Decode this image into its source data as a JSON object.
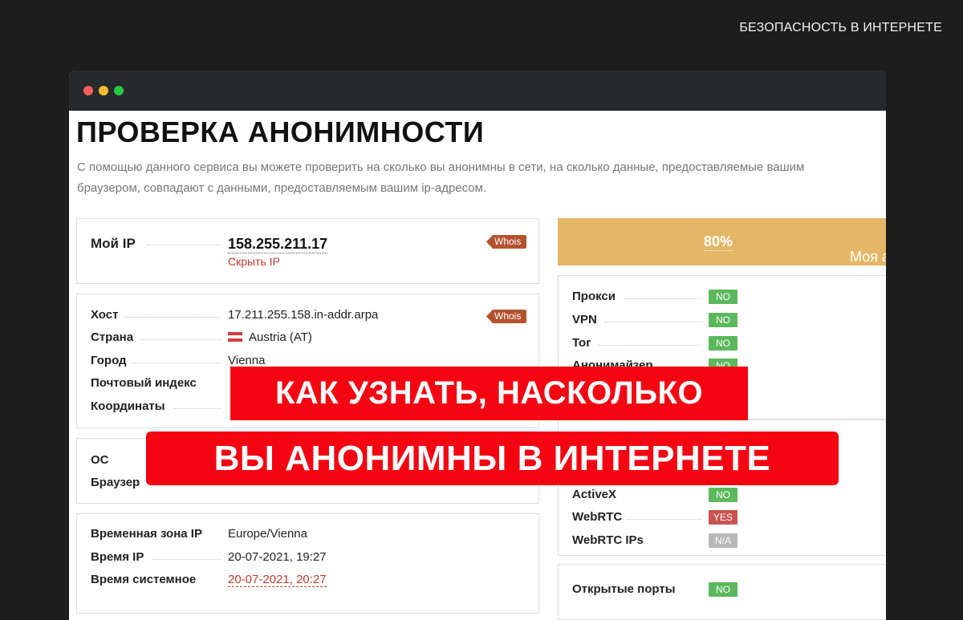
{
  "category": "БЕЗОПАСНОСТЬ В ИНТЕРНЕТЕ",
  "page": {
    "title": "ПРОВЕРКА АНОНИМНОСТИ",
    "description_line1": "С помощью данного сервиса вы можете проверить на сколько вы анонимны в сети, на сколько данные, предоставляемые вашим",
    "description_line2": "браузером, совпадают с данными, предоставляемым вашим ip-адресом."
  },
  "ip_box": {
    "label": "Мой IP",
    "value": "158.255.211.17",
    "hide_link": "Скрыть IP",
    "whois": "Whois"
  },
  "host_box": {
    "whois": "Whois",
    "rows": [
      {
        "label": "Хост",
        "value": "17.211.255.158.in-addr.arpa"
      },
      {
        "label": "Страна",
        "value": "Austria (AT)"
      },
      {
        "label": "Город",
        "value": "Vienna"
      },
      {
        "label": "Почтовый индекс",
        "value": ""
      },
      {
        "label": "Координаты",
        "value": ""
      }
    ]
  },
  "os_box": {
    "rows": [
      {
        "label": "ОС",
        "value": ""
      },
      {
        "label": "Браузер",
        "value": ""
      }
    ]
  },
  "time_box": {
    "rows": [
      {
        "label": "Временная зона IP",
        "value": "Europe/Vienna"
      },
      {
        "label": "Время IP",
        "value": "20-07-2021, 19:27"
      },
      {
        "label": "Время системное",
        "value": "20-07-2021, 20:27"
      }
    ]
  },
  "anonymity": {
    "label": "Моя анонимность:",
    "percent": "80%"
  },
  "checks_top": [
    {
      "label": "Прокси",
      "status": "NO"
    },
    {
      "label": "VPN",
      "status": "NO"
    },
    {
      "label": "Tor",
      "status": "NO"
    },
    {
      "label": "Анонимайзер",
      "status": "NO"
    }
  ],
  "checks_bottom": [
    {
      "label": "ActiveX",
      "status": "NO"
    },
    {
      "label": "WebRTC",
      "status": "YES"
    },
    {
      "label": "WebRTC IPs",
      "status": "N/A"
    }
  ],
  "ports": {
    "label": "Открытые порты",
    "status": "NO"
  },
  "overlay": {
    "line1": "КАК УЗНАТЬ, НАСКОЛЬКО",
    "line2": "ВЫ АНОНИМНЫ В ИНТЕРНЕТЕ"
  },
  "colors": {
    "background": "#1d1d1d",
    "banner": "#e4b766",
    "overlay": "#f30612",
    "status_no": "#5cb85c",
    "status_yes": "#c9534f",
    "status_na": "#b8b8b8",
    "whois": "#b5522e"
  }
}
